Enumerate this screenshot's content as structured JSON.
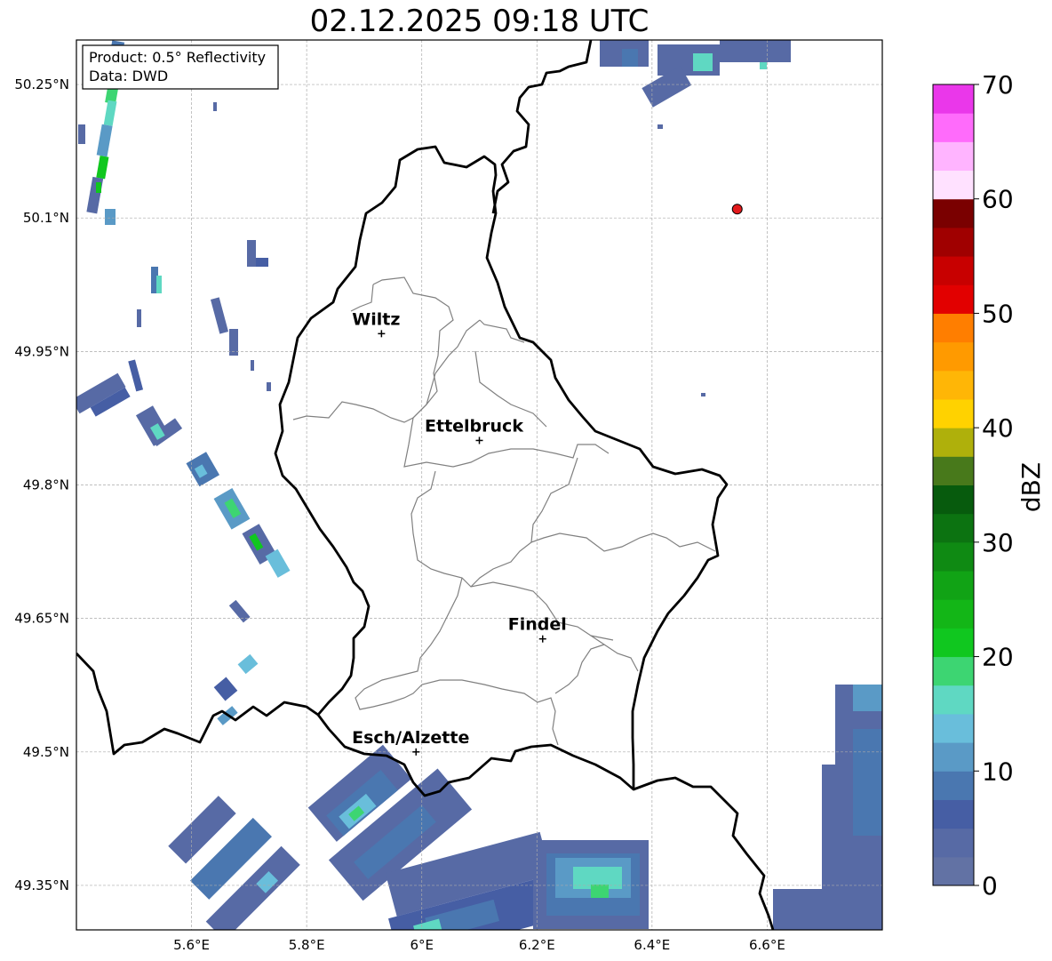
{
  "title": "02.12.2025 09:18 UTC",
  "info_box": {
    "product": "Product: 0.5° Reflectivity",
    "source": "Data: DWD"
  },
  "map": {
    "lon_range": [
      5.4,
      6.8
    ],
    "lat_range": [
      49.3,
      50.3
    ],
    "grid": true,
    "lon_ticks": [
      "5.6°E",
      "5.8°E",
      "6°E",
      "6.2°E",
      "6.4°E",
      "6.6°E"
    ],
    "lon_tick_values": [
      5.6,
      5.8,
      6.0,
      6.2,
      6.4,
      6.6
    ],
    "lat_ticks": [
      "50.25°N",
      "50.1°N",
      "49.95°N",
      "49.8°N",
      "49.65°N",
      "49.5°N",
      "49.35°N"
    ],
    "lat_tick_values": [
      50.25,
      50.1,
      49.95,
      49.8,
      49.65,
      49.5,
      49.35
    ],
    "cities": [
      {
        "name": "Wiltz",
        "lon": 5.93,
        "lat": 49.97
      },
      {
        "name": "Ettelbruck",
        "lon": 6.1,
        "lat": 49.85
      },
      {
        "name": "Findel",
        "lon": 6.21,
        "lat": 49.627
      },
      {
        "name": "Esch/Alzette",
        "lon": 5.99,
        "lat": 49.5
      }
    ],
    "radar_site": {
      "lon": 6.548,
      "lat": 50.11,
      "color": "#e31a1c"
    }
  },
  "colorbar": {
    "label": "dBZ",
    "min": 0,
    "max": 70,
    "ticks": [
      "0",
      "10",
      "20",
      "30",
      "40",
      "50",
      "60",
      "70"
    ],
    "colors": [
      "#6272a4",
      "#576aa5",
      "#465ea4",
      "#4a77b0",
      "#5a9ac6",
      "#69bedb",
      "#5fd8c2",
      "#3dd572",
      "#10c71f",
      "#13b617",
      "#11a315",
      "#0f8a13",
      "#0c7311",
      "#075b0d",
      "#48791b",
      "#afb00b",
      "#ffd200",
      "#ffb606",
      "#ff9a00",
      "#ff7e00",
      "#e20000",
      "#c80000",
      "#a00000",
      "#7a0000",
      "#ffe1ff",
      "#ffb4ff",
      "#ff6bfb",
      "#ea37ea"
    ]
  }
}
